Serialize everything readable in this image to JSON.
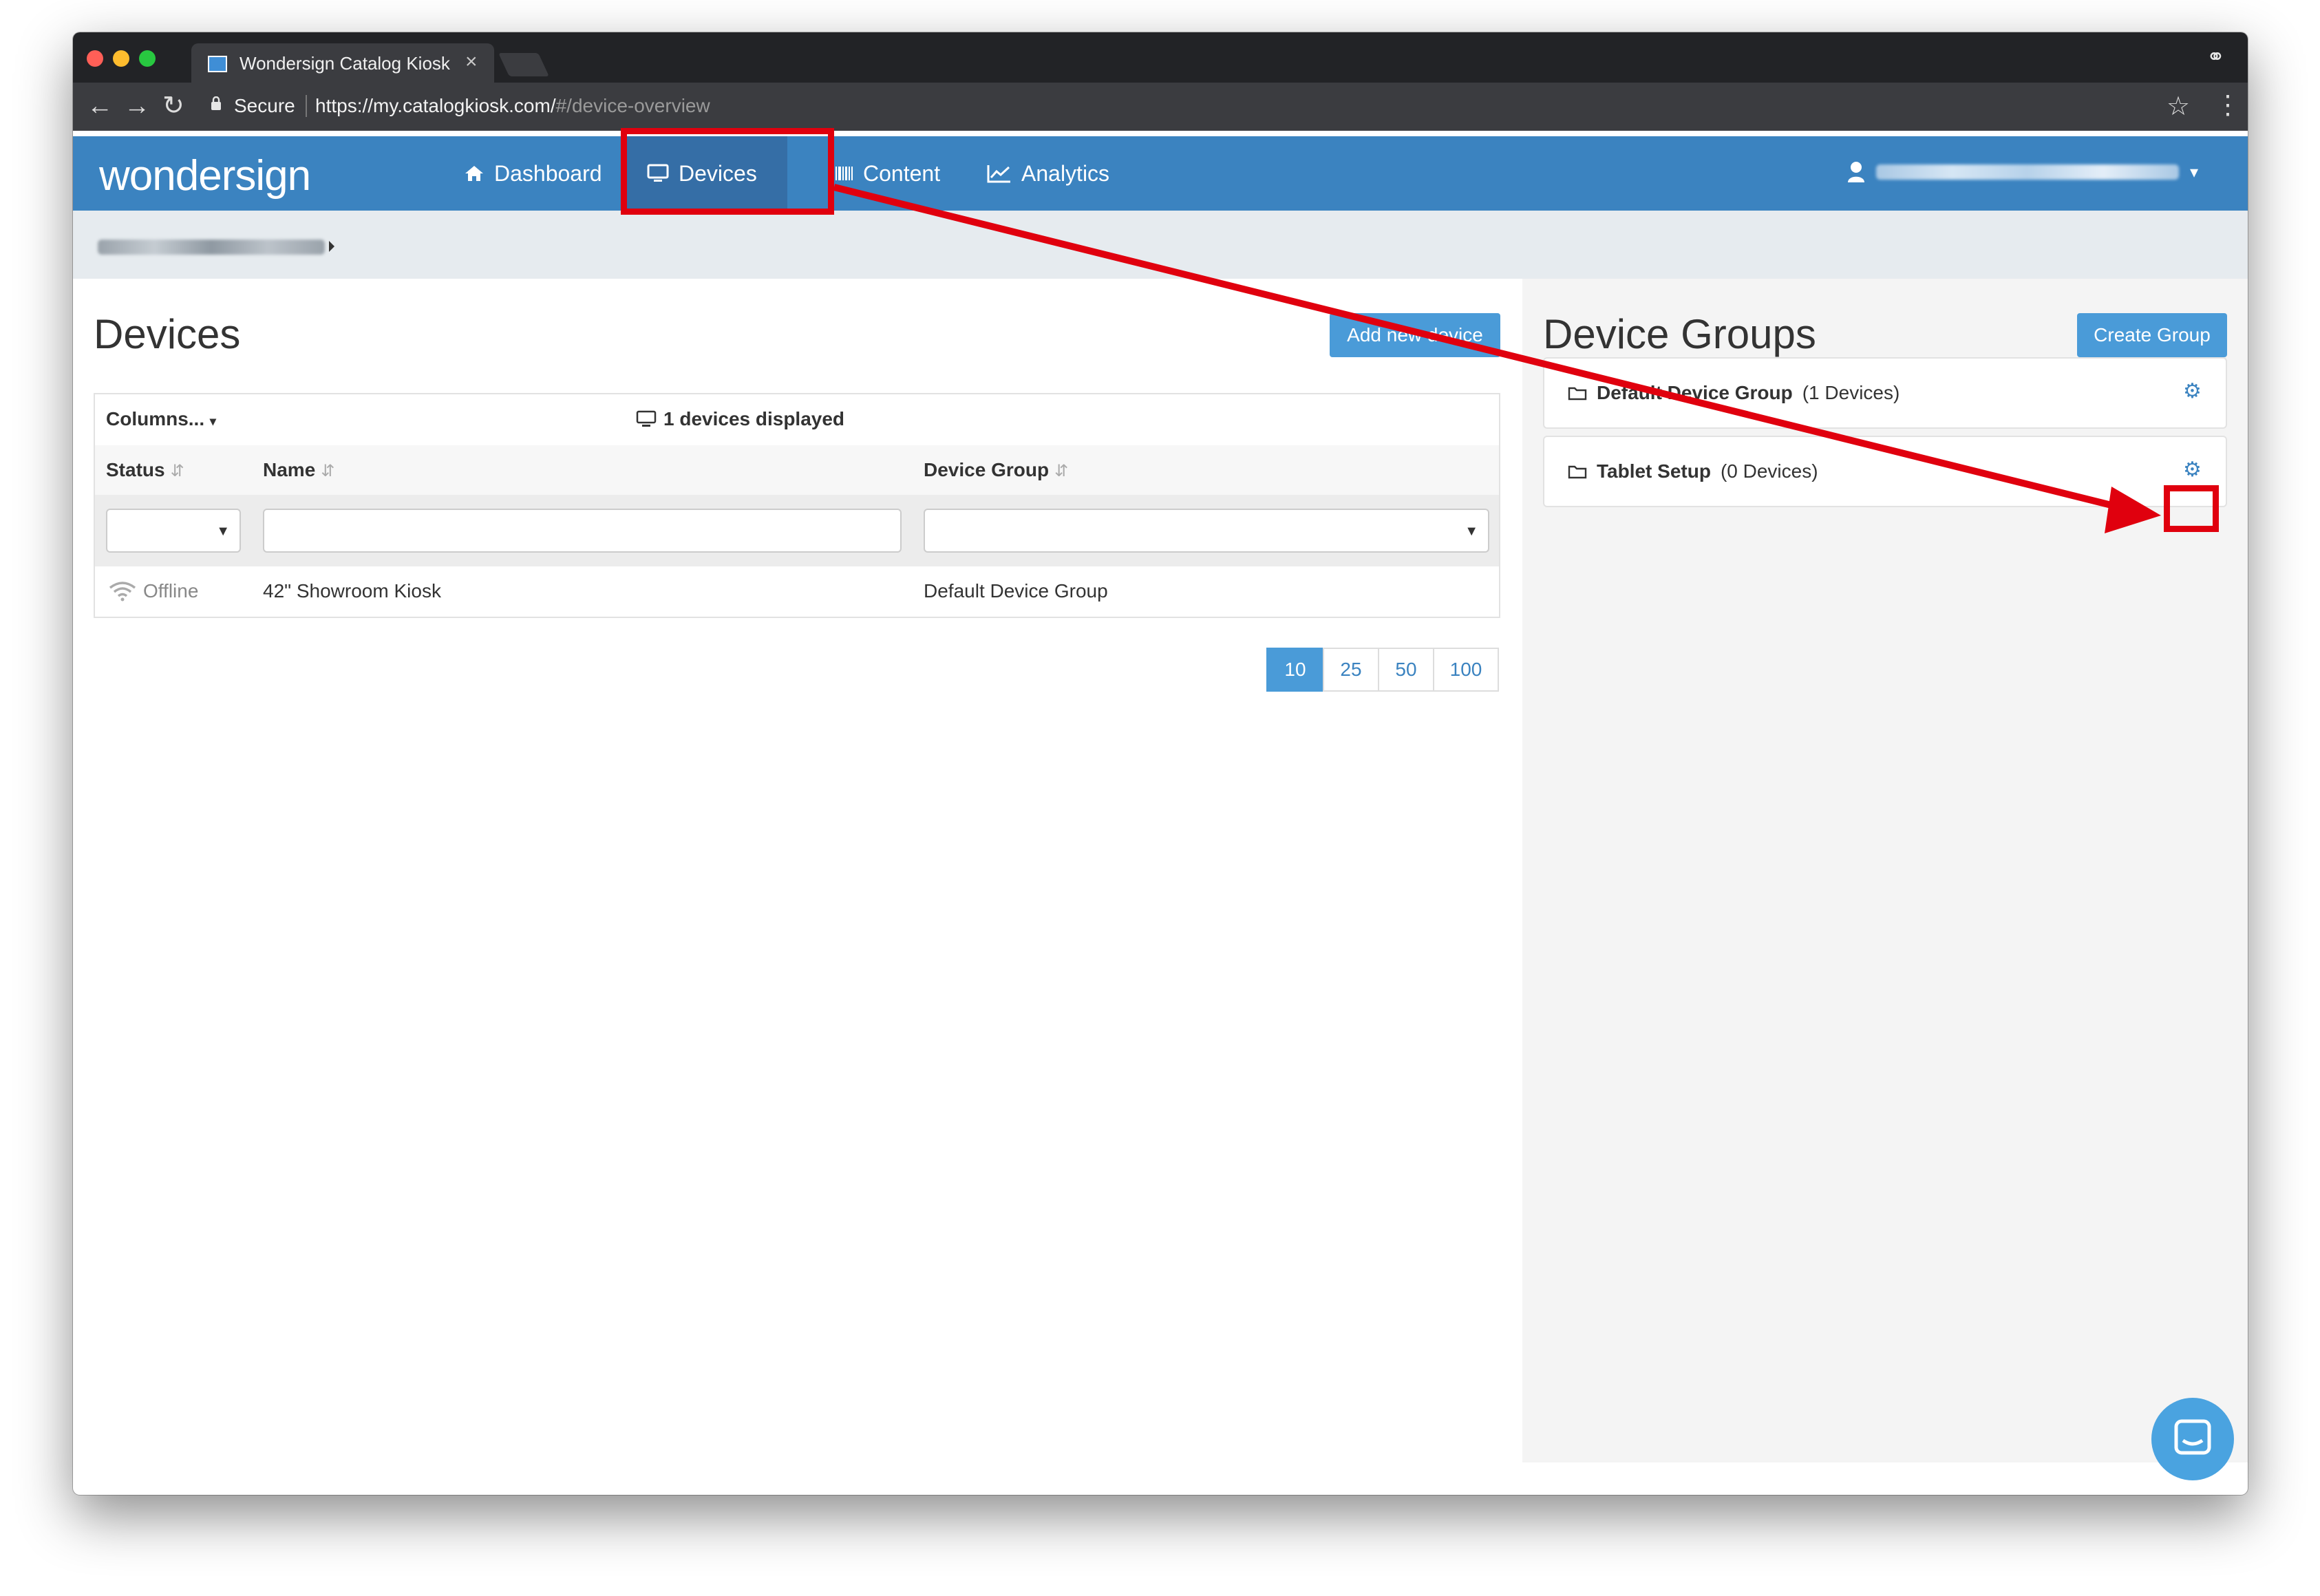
{
  "browser": {
    "tab_title": "Wondersign Catalog Kiosk",
    "tab_close": "×",
    "secure_label": "Secure",
    "url_host": "https://my.catalogkiosk.com/",
    "url_path": "#/device-overview"
  },
  "navbar": {
    "brand": "wondersign",
    "items": [
      {
        "label": "Dashboard",
        "icon": "home-icon"
      },
      {
        "label": "Devices",
        "icon": "monitor-icon",
        "active": true
      },
      {
        "label": "Content",
        "icon": "barcode-icon"
      },
      {
        "label": "Analytics",
        "icon": "line-chart-icon"
      }
    ],
    "user_caret": "▾"
  },
  "devices": {
    "title": "Devices",
    "add_button": "Add new device",
    "columns_button": "Columns...",
    "count_label": "1 devices displayed",
    "headers": [
      "Status",
      "Name",
      "Device Group"
    ],
    "rows": [
      {
        "status": "Offline",
        "name": "42\" Showroom Kiosk",
        "group": "Default Device Group"
      }
    ],
    "page_sizes": [
      "10",
      "25",
      "50",
      "100"
    ],
    "active_page_size": "10"
  },
  "groups": {
    "title": "Device Groups",
    "create_button": "Create Group",
    "items": [
      {
        "name": "Default Device Group",
        "count": "(1 Devices)"
      },
      {
        "name": "Tablet Setup",
        "count": "(0 Devices)"
      }
    ]
  },
  "colors": {
    "navbar": "#3b83c0",
    "primary_button": "#4a9bd8",
    "annotation": "#e0000e"
  }
}
